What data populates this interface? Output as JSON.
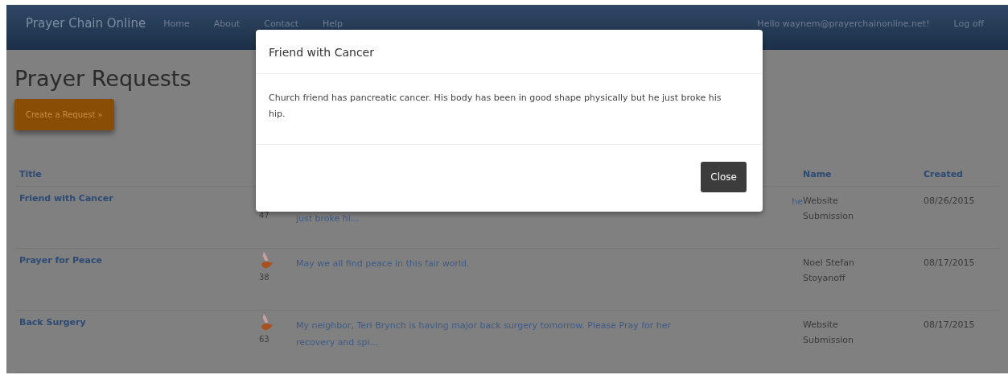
{
  "navbar": {
    "brand": "Prayer Chain Online",
    "links": [
      "Home",
      "About",
      "Contact",
      "Help"
    ],
    "greeting": "Hello waynem@prayerchainonline.net!",
    "logoff": "Log off"
  },
  "page": {
    "heading": "Prayer Requests",
    "create_button": "Create a Request »"
  },
  "table": {
    "columns": {
      "title": "Title",
      "name": "Name",
      "created": "Created"
    },
    "rows": [
      {
        "title": "Friend with Cancer",
        "count": "47",
        "description": [
          "he",
          "just broke hi..."
        ],
        "name": "Website Submission",
        "created": "08/26/2015"
      },
      {
        "title": "Prayer for Peace",
        "count": "38",
        "description": [
          "May we all find peace in this fair world."
        ],
        "name": "Noel Stefan Stoyanoff",
        "created": "08/17/2015"
      },
      {
        "title": "Back Surgery",
        "count": "63",
        "description": [
          "My neighbor, Teri Brynch is having major back surgery tomorrow. Please Pray for her",
          "recovery and spi..."
        ],
        "name": "Website Submission",
        "created": "08/17/2015"
      }
    ]
  },
  "modal": {
    "title": "Friend with Cancer",
    "body": "Church friend has pancreatic cancer. His body has been in good shape physically but he just broke his hip.",
    "close_button": "Close"
  }
}
